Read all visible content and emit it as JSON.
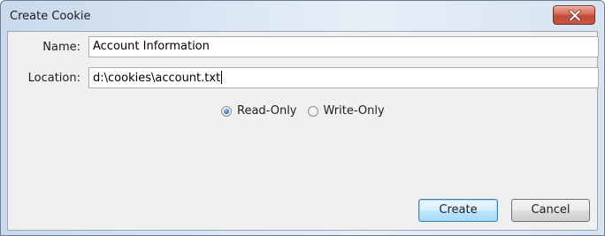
{
  "window": {
    "title": "Create Cookie"
  },
  "form": {
    "name_label": "Name:",
    "name_value": "Account Information",
    "location_label": "Location:",
    "location_value": "d:\\cookies\\account.txt"
  },
  "access": {
    "options": [
      {
        "label": "Read-Only",
        "checked": true
      },
      {
        "label": "Write-Only",
        "checked": false
      }
    ]
  },
  "buttons": {
    "create_label": "Create",
    "cancel_label": "Cancel"
  },
  "icons": {
    "close": "close-icon"
  },
  "colors": {
    "close_button": "#c9503d",
    "default_button_border": "#3c7fb1",
    "radio_checked": "#2c78c4"
  }
}
